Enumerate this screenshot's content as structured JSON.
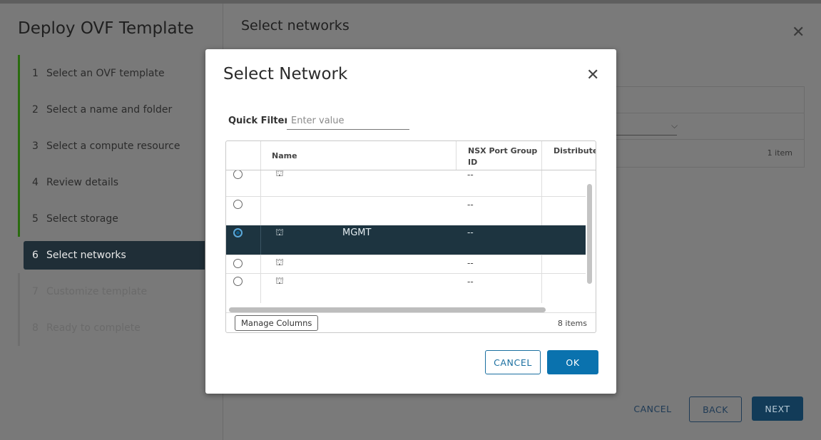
{
  "wizard": {
    "title": "Deploy OVF Template",
    "steps": [
      {
        "num": "1",
        "label": "Select an OVF template"
      },
      {
        "num": "2",
        "label": "Select a name and folder"
      },
      {
        "num": "3",
        "label": "Select a compute resource"
      },
      {
        "num": "4",
        "label": "Review details"
      },
      {
        "num": "5",
        "label": "Select storage"
      },
      {
        "num": "6",
        "label": "Select networks"
      },
      {
        "num": "7",
        "label": "Customize template"
      },
      {
        "num": "8",
        "label": "Ready to complete"
      }
    ],
    "page_title": "Select networks",
    "items_count": "1 item",
    "buttons": {
      "cancel": "CANCEL",
      "back": "BACK",
      "next": "NEXT"
    }
  },
  "modal": {
    "title": "Select Network",
    "quick_filter_label": "Quick Filter",
    "quick_filter_placeholder": "Enter value",
    "columns": {
      "name": "Name",
      "nsx": "NSX Port Group ID",
      "dist": "Distributed Switch"
    },
    "rows": [
      {
        "name": "",
        "nsx": "--",
        "selected": false
      },
      {
        "name": "",
        "nsx": "--",
        "selected": false
      },
      {
        "name": "MGMT",
        "nsx": "--",
        "selected": true
      },
      {
        "name": "",
        "nsx": "--",
        "selected": false
      },
      {
        "name": "",
        "nsx": "--",
        "selected": false
      }
    ],
    "manage_columns": "Manage Columns",
    "items_count": "8 items",
    "buttons": {
      "cancel": "CANCEL",
      "ok": "OK"
    }
  }
}
